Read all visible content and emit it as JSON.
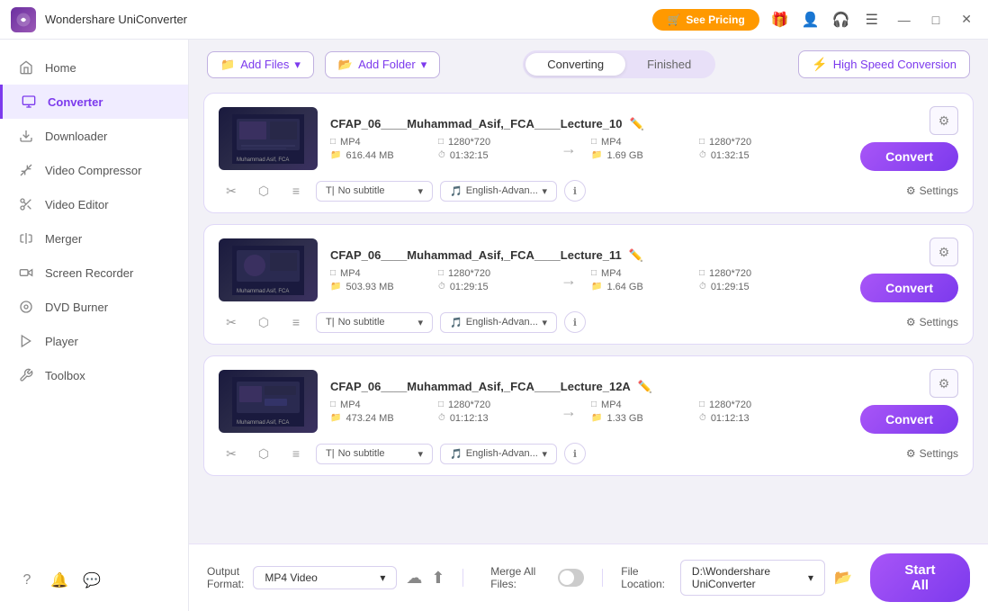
{
  "app": {
    "logo_color": "#7c3aed",
    "title": "Wondershare UniConverter"
  },
  "titlebar": {
    "title": "Wondershare UniConverter",
    "see_pricing": "See Pricing",
    "window_btns": [
      "—",
      "□",
      "✕"
    ]
  },
  "sidebar": {
    "items": [
      {
        "id": "home",
        "label": "Home",
        "icon": "home"
      },
      {
        "id": "converter",
        "label": "Converter",
        "icon": "converter",
        "active": true
      },
      {
        "id": "downloader",
        "label": "Downloader",
        "icon": "downloader"
      },
      {
        "id": "video-compressor",
        "label": "Video Compressor",
        "icon": "compress"
      },
      {
        "id": "video-editor",
        "label": "Video Editor",
        "icon": "edit"
      },
      {
        "id": "merger",
        "label": "Merger",
        "icon": "merge"
      },
      {
        "id": "screen-recorder",
        "label": "Screen Recorder",
        "icon": "record"
      },
      {
        "id": "dvd-burner",
        "label": "DVD Burner",
        "icon": "dvd"
      },
      {
        "id": "player",
        "label": "Player",
        "icon": "player"
      },
      {
        "id": "toolbox",
        "label": "Toolbox",
        "icon": "toolbox"
      }
    ],
    "bottom_icons": [
      "question",
      "bell",
      "chat"
    ]
  },
  "toolbar": {
    "add_file_label": "+",
    "add_file_text": "Add Files",
    "add_folder_label": "+",
    "add_folder_text": "Add Folder",
    "tabs": [
      {
        "id": "converting",
        "label": "Converting",
        "active": true
      },
      {
        "id": "finished",
        "label": "Finished",
        "active": false
      }
    ],
    "high_speed": "High Speed Conversion"
  },
  "files": [
    {
      "id": "file1",
      "name": "CFAP_06____Muhammad_Asif,_FCA____Lecture_10",
      "src_format": "MP4",
      "src_resolution": "1280*720",
      "src_size": "616.44 MB",
      "src_duration": "01:32:15",
      "dst_format": "MP4",
      "dst_resolution": "1280*720",
      "dst_size": "1.69 GB",
      "dst_duration": "01:32:15",
      "subtitle": "No subtitle",
      "audio": "English-Advan...",
      "convert_label": "Convert",
      "settings_label": "Settings"
    },
    {
      "id": "file2",
      "name": "CFAP_06____Muhammad_Asif,_FCA____Lecture_11",
      "src_format": "MP4",
      "src_resolution": "1280*720",
      "src_size": "503.93 MB",
      "src_duration": "01:29:15",
      "dst_format": "MP4",
      "dst_resolution": "1280*720",
      "dst_size": "1.64 GB",
      "dst_duration": "01:29:15",
      "subtitle": "No subtitle",
      "audio": "English-Advan...",
      "convert_label": "Convert",
      "settings_label": "Settings"
    },
    {
      "id": "file3",
      "name": "CFAP_06____Muhammad_Asif,_FCA____Lecture_12A",
      "src_format": "MP4",
      "src_resolution": "1280*720",
      "src_size": "473.24 MB",
      "src_duration": "01:12:13",
      "dst_format": "MP4",
      "dst_resolution": "1280*720",
      "dst_size": "1.33 GB",
      "dst_duration": "01:12:13",
      "subtitle": "No subtitle",
      "audio": "English-Advan...",
      "convert_label": "Convert",
      "settings_label": "Settings"
    }
  ],
  "bottom": {
    "output_format_label": "Output Format:",
    "output_format_value": "MP4 Video",
    "file_location_label": "File Location:",
    "file_location_value": "D:\\Wondershare UniConverter",
    "merge_label": "Merge All Files:",
    "start_all": "Start All"
  }
}
